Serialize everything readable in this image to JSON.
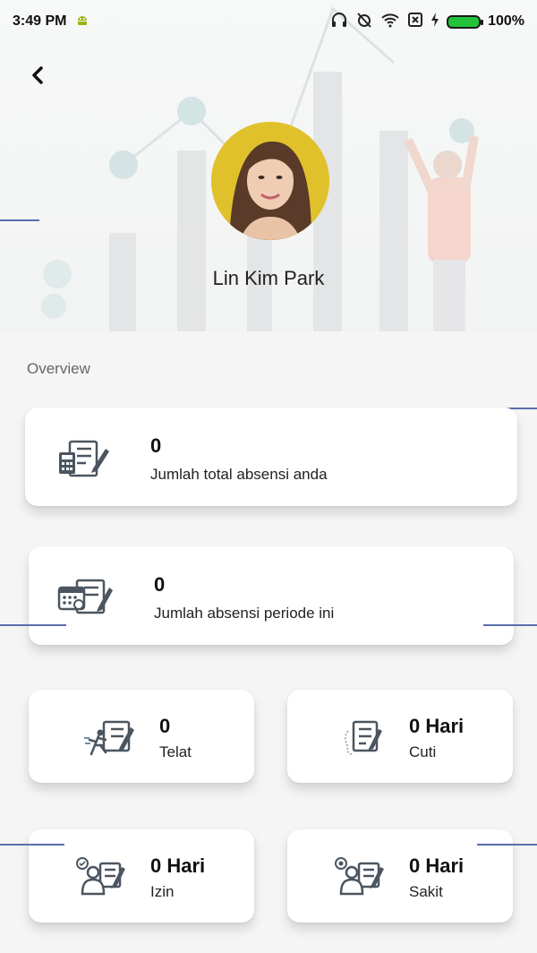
{
  "status_bar": {
    "time": "3:49 PM",
    "battery_text": "100%",
    "icons": [
      "android-icon",
      "headphones-icon",
      "alarm-off-icon",
      "wifi-icon",
      "sim-off-icon",
      "charging-icon",
      "battery-icon"
    ]
  },
  "profile": {
    "name": "Lin Kim Park"
  },
  "overview": {
    "title": "Overview",
    "total": {
      "value": "0",
      "label": "Jumlah total absensi anda",
      "icon": "calculator-form-icon"
    },
    "period": {
      "value": "0",
      "label": "Jumlah absensi periode ini",
      "icon": "calendar-form-icon"
    },
    "late": {
      "value": "0",
      "label": "Telat",
      "icon": "running-late-icon"
    },
    "leave": {
      "value": "0 Hari",
      "label": "Cuti",
      "icon": "leave-form-icon"
    },
    "permit": {
      "value": "0 Hari",
      "label": "Izin",
      "icon": "permit-person-icon"
    },
    "sick": {
      "value": "0 Hari",
      "label": "Sakit",
      "icon": "sick-person-icon"
    }
  },
  "colors": {
    "background": "#f5f5f5",
    "card": "#ffffff",
    "icon_gray": "#4a5560",
    "accent_line": "#5a6db0",
    "battery": "#22c33a"
  }
}
